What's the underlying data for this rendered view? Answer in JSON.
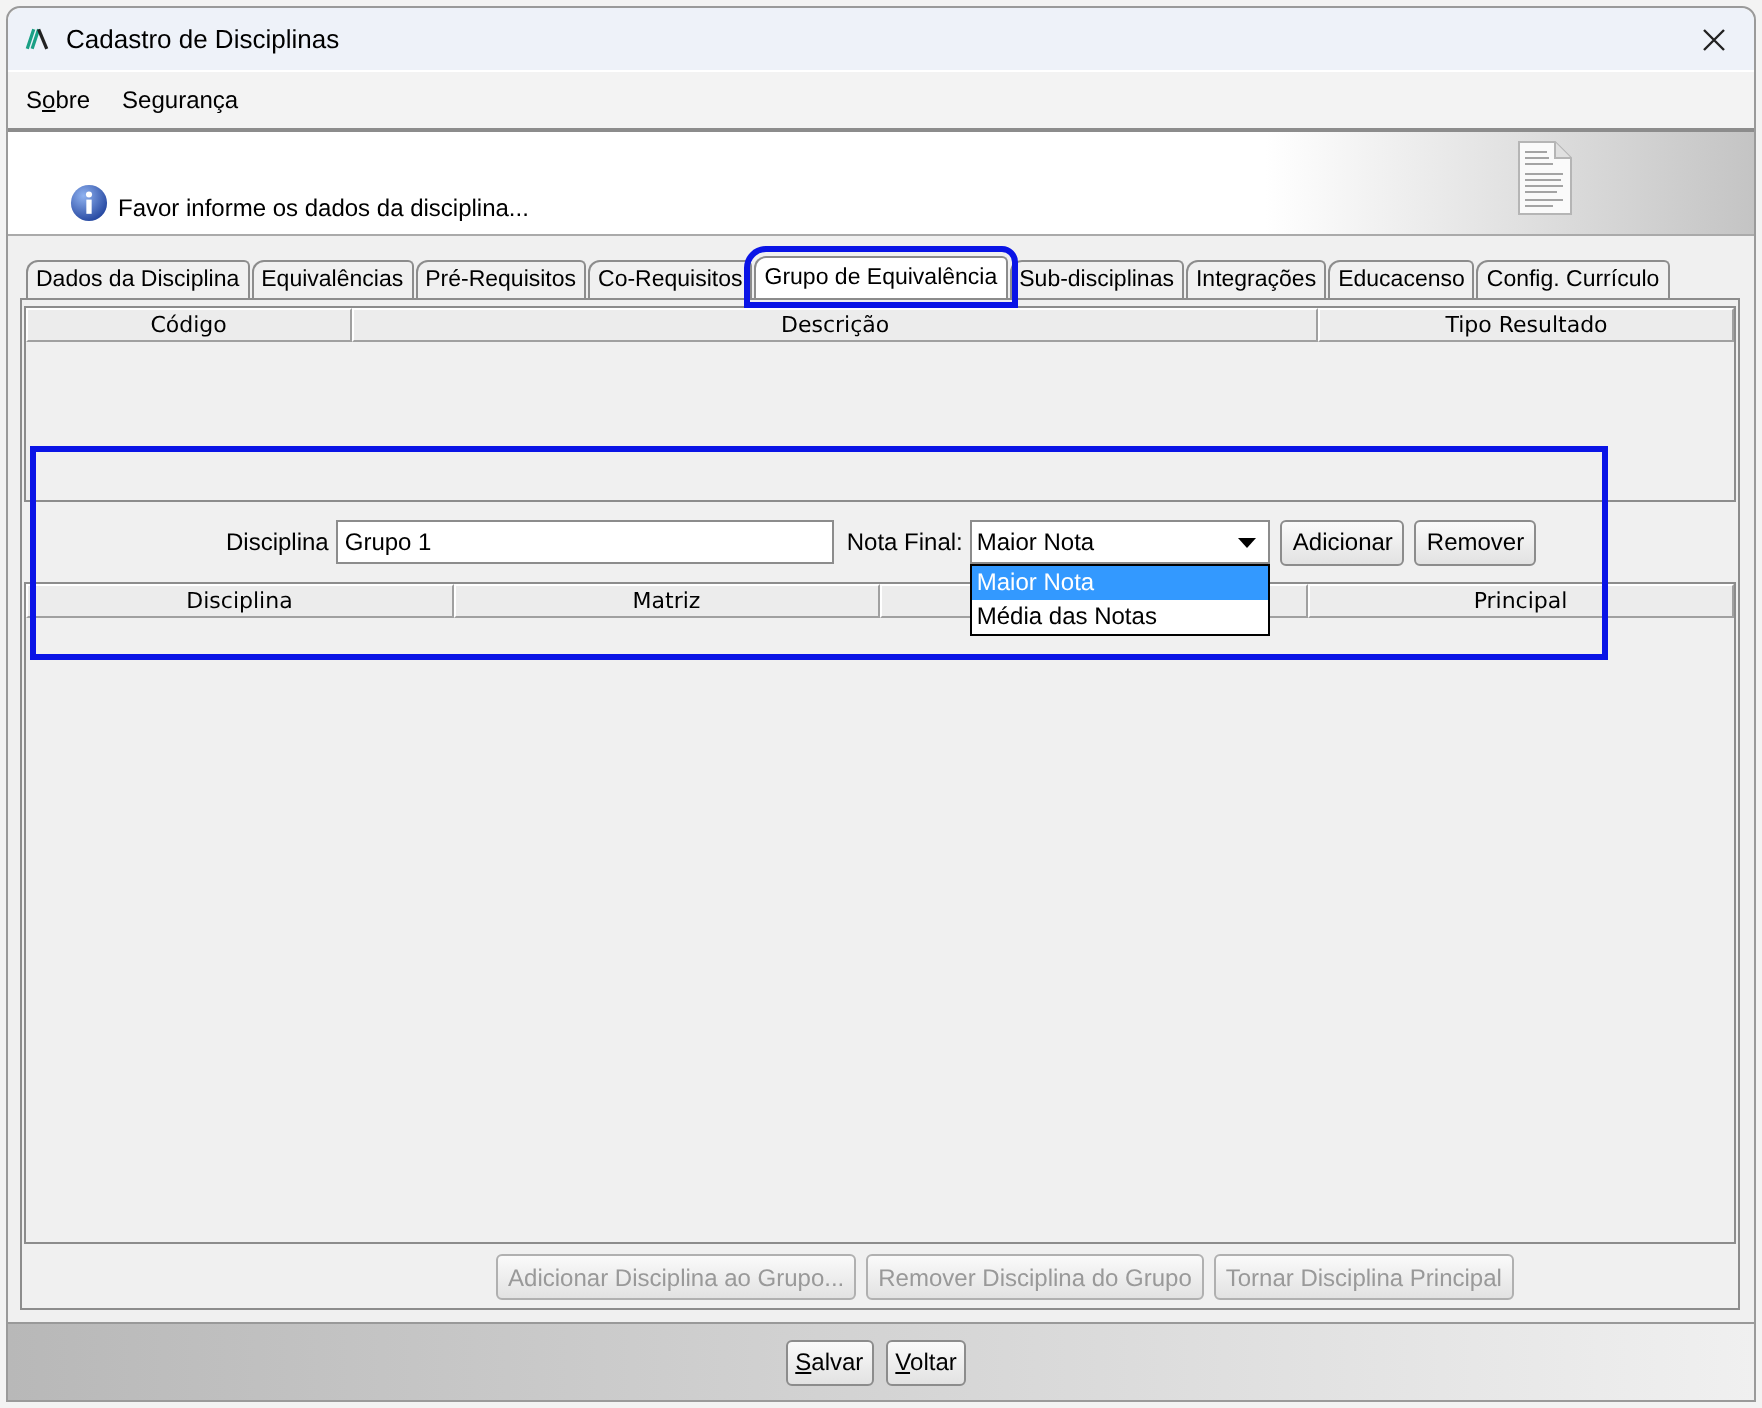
{
  "window": {
    "title": "Cadastro de Disciplinas"
  },
  "menu": [
    {
      "label": {
        "before": "S",
        "underlined": "o",
        "after": "bre"
      }
    },
    {
      "label": {
        "before": "Segurança"
      }
    }
  ],
  "header": {
    "message": "Favor informe os dados da disciplina..."
  },
  "tabs": [
    {
      "label": "Dados da Disciplina",
      "selected": false,
      "highlighted": false
    },
    {
      "label": "Equivalências",
      "selected": false,
      "highlighted": false
    },
    {
      "label": "Pré-Requisitos",
      "selected": false,
      "highlighted": false
    },
    {
      "label": "Co-Requisitos",
      "selected": false,
      "highlighted": false
    },
    {
      "label": "Grupo de Equivalência",
      "selected": true,
      "highlighted": true
    },
    {
      "label": "Sub-disciplinas",
      "selected": false,
      "highlighted": false
    },
    {
      "label": "Integrações",
      "selected": false,
      "highlighted": false
    },
    {
      "label": "Educacenso",
      "selected": false,
      "highlighted": false
    },
    {
      "label": "Config. Currículo",
      "selected": false,
      "highlighted": false
    }
  ],
  "equivalence_table": {
    "columns": [
      "Código",
      "Descrição",
      "Tipo Resultado"
    ]
  },
  "group_form": {
    "highlighted": true,
    "discipline_label": "Disciplina",
    "discipline_value": "Grupo 1",
    "final_grade_label": "Nota Final:",
    "final_grade_value": "Maior Nota",
    "dropdown": {
      "expanded": true,
      "options": [
        {
          "label": "Maior Nota",
          "selected": true
        },
        {
          "label": "Média das Notas",
          "selected": false
        }
      ]
    },
    "buttons": [
      "Adicionar",
      "Remover"
    ]
  },
  "group_table": {
    "columns": [
      {
        "kind": "text",
        "label": "Disciplina"
      },
      {
        "kind": "text",
        "label": "Matriz"
      },
      {
        "kind": "blank"
      },
      {
        "kind": "text",
        "label": "Principal"
      }
    ]
  },
  "group_actions": [
    {
      "label": "Adicionar Disciplina ao Grupo...",
      "disabled": true
    },
    {
      "label": "Remover Disciplina do Grupo",
      "disabled": true
    },
    {
      "label": "Tornar Disciplina Principal",
      "disabled": true
    }
  ],
  "footer_buttons": [
    {
      "label": {
        "underlined": "S",
        "after": "alvar"
      }
    },
    {
      "label": {
        "underlined": "V",
        "after": "oltar"
      }
    }
  ]
}
